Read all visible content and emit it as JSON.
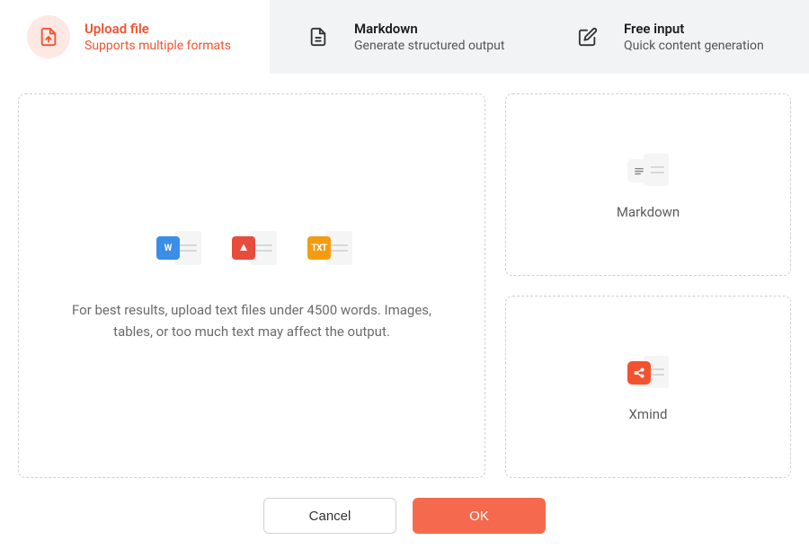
{
  "tabs": [
    {
      "title": "Upload file",
      "subtitle": "Supports multiple formats"
    },
    {
      "title": "Markdown",
      "subtitle": "Generate structured output"
    },
    {
      "title": "Free input",
      "subtitle": "Quick content generation"
    }
  ],
  "upload": {
    "file_types": {
      "word": "W",
      "pdf_glyph": "▲",
      "txt": "TXT"
    },
    "hint": "For best results, upload text files under 4500 words. Images, tables, or too much text may affect the output."
  },
  "side_cards": [
    {
      "label": "Markdown"
    },
    {
      "label": "Xmind"
    }
  ],
  "buttons": {
    "cancel": "Cancel",
    "ok": "OK"
  },
  "colors": {
    "accent": "#f2532f",
    "ok_button": "#f56a4f"
  }
}
